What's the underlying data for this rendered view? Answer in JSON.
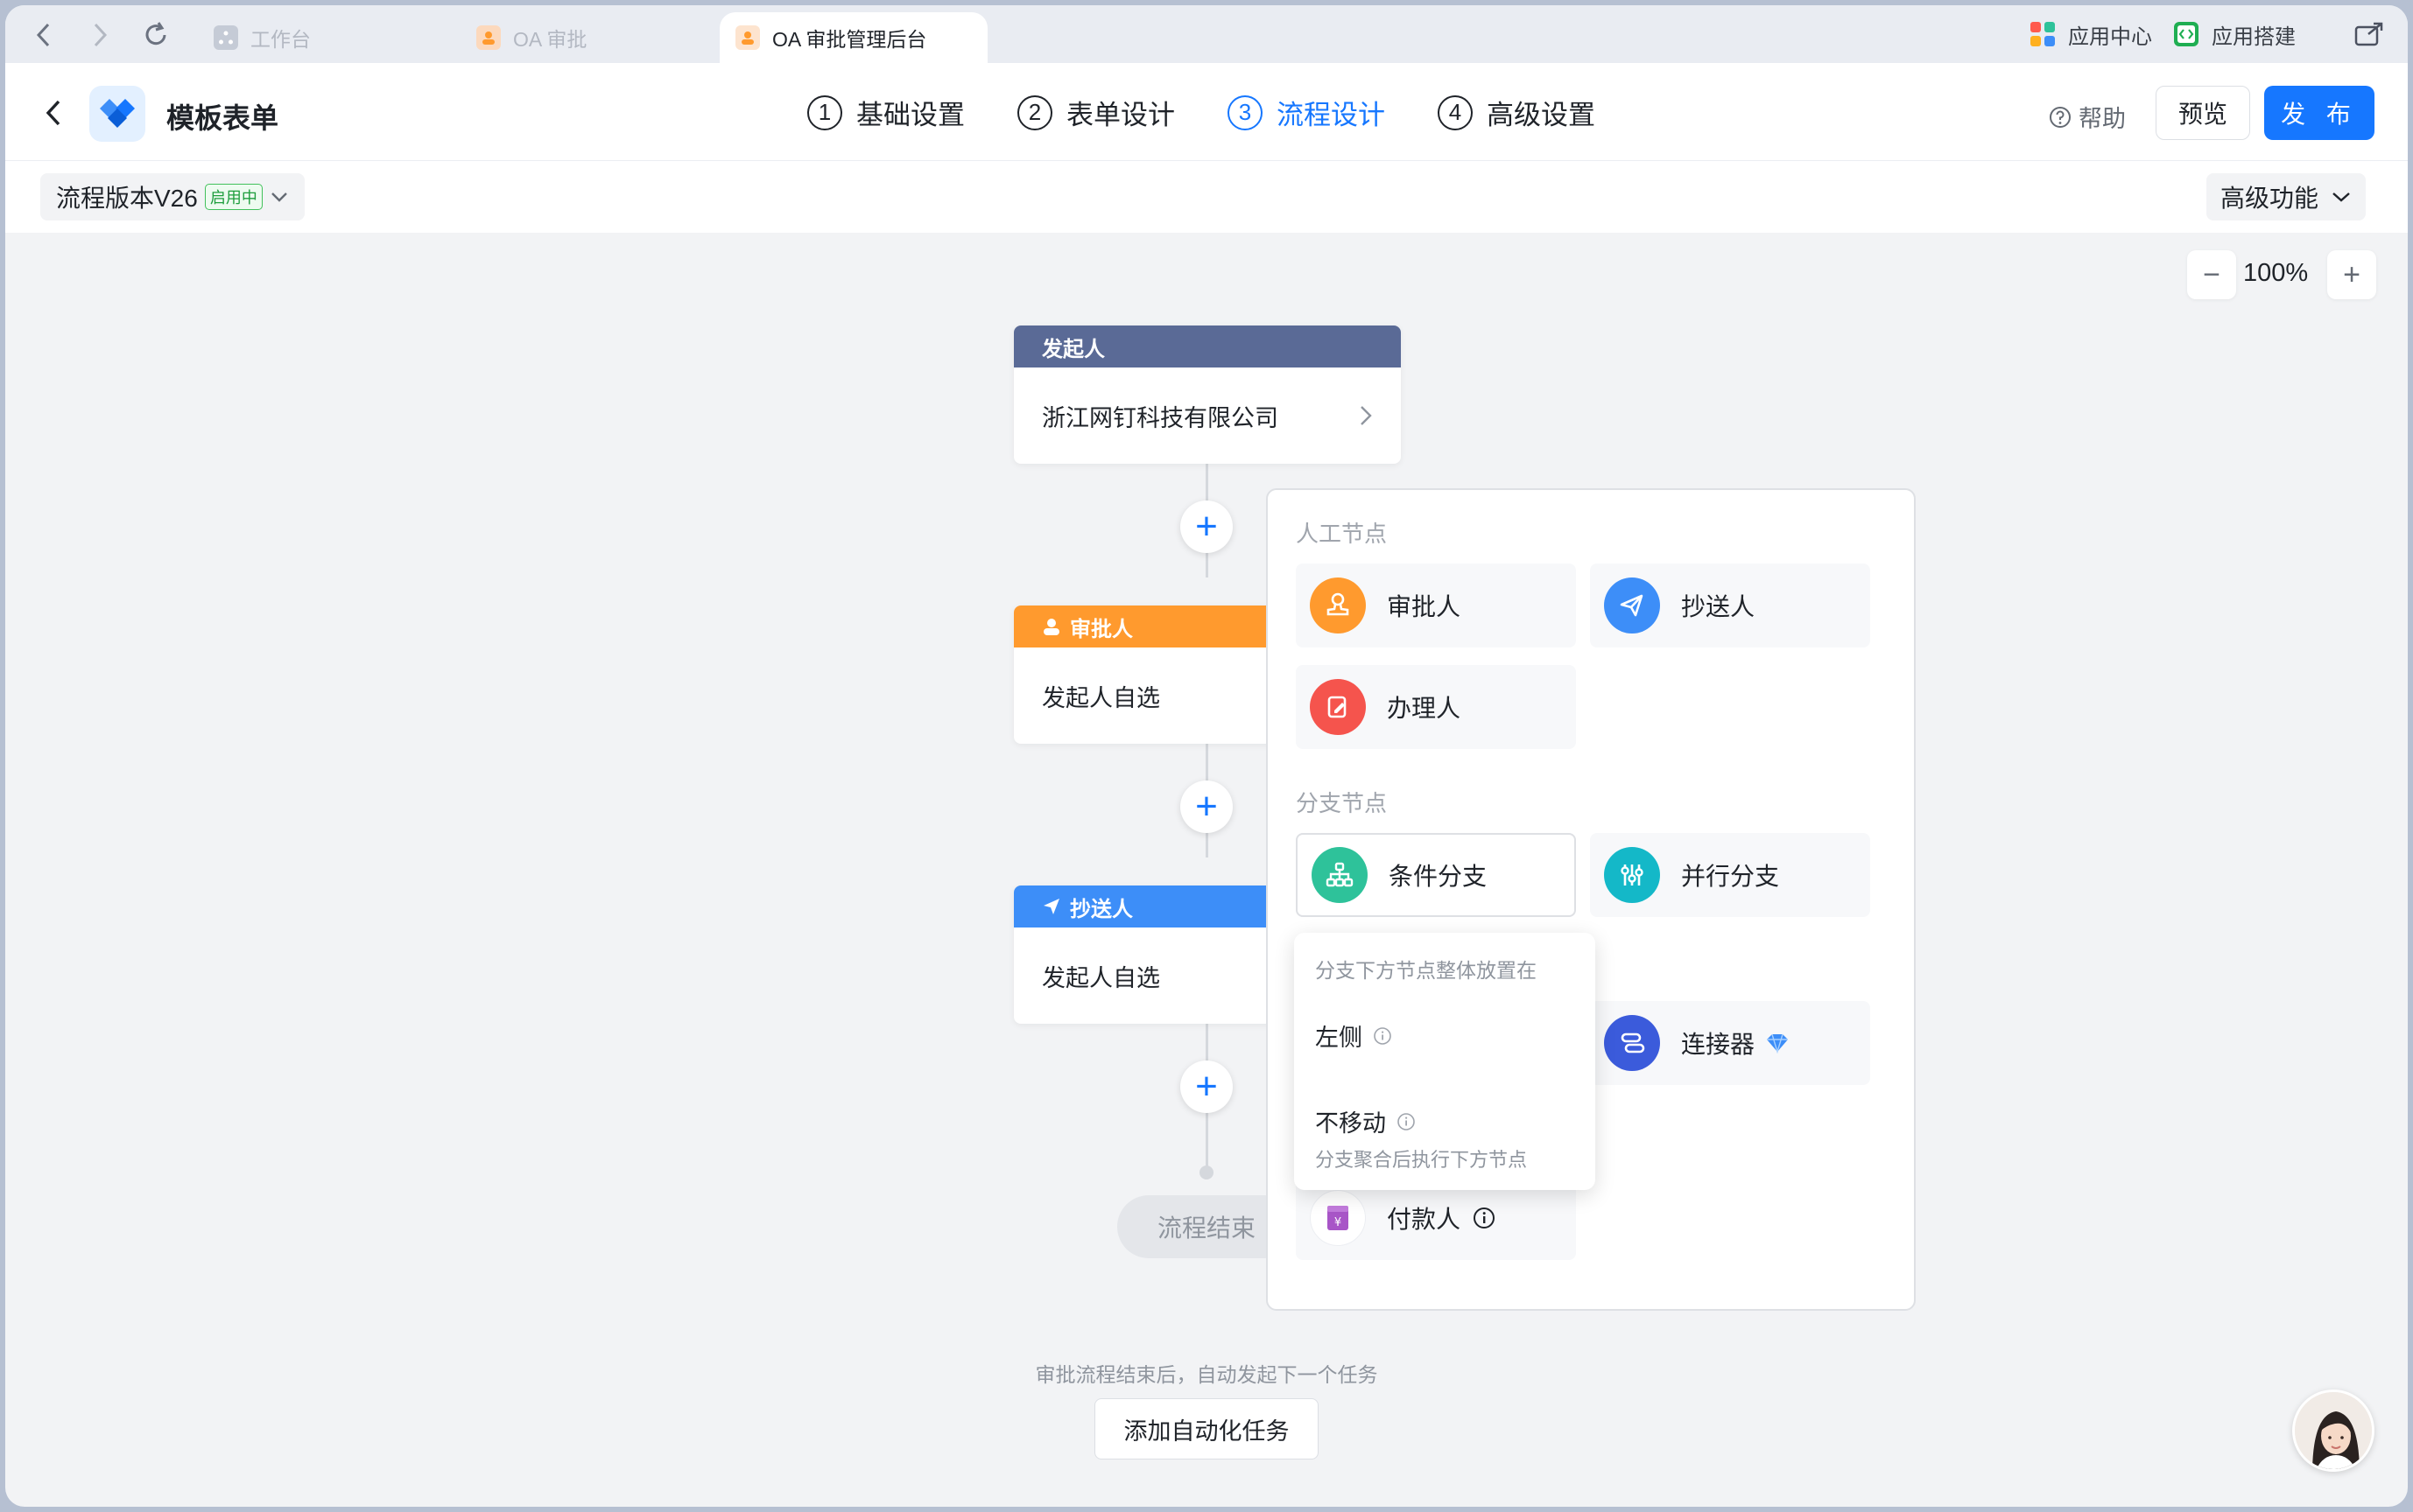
{
  "browser": {
    "tabs": [
      {
        "label": "工作台"
      },
      {
        "label": "OA 审批"
      },
      {
        "label": "OA 审批管理后台"
      }
    ],
    "app_center": "应用中心",
    "app_builder": "应用搭建"
  },
  "header": {
    "title": "模板表单",
    "steps": [
      {
        "num": "1",
        "label": "基础设置"
      },
      {
        "num": "2",
        "label": "表单设计"
      },
      {
        "num": "3",
        "label": "流程设计",
        "active": true
      },
      {
        "num": "4",
        "label": "高级设置"
      }
    ],
    "help": "帮助",
    "preview": "预览",
    "publish": "发 布"
  },
  "toolbar": {
    "version": "流程版本V26",
    "status_badge": "启用中",
    "advanced": "高级功能"
  },
  "zoom": {
    "level": "100%"
  },
  "flow": {
    "initiator": {
      "header": "发起人",
      "body": "浙江网钉科技有限公司"
    },
    "approver": {
      "header": "审批人",
      "body": "发起人自选"
    },
    "cc": {
      "header": "抄送人",
      "body": "发起人自选"
    },
    "end": "流程结束",
    "after_note": "审批流程结束后，自动发起下一个任务",
    "add_task": "添加自动化任务"
  },
  "picker": {
    "manual_title": "人工节点",
    "manual": [
      {
        "label": "审批人",
        "icon": "stamp-icon",
        "color": "#ff9a2e"
      },
      {
        "label": "抄送人",
        "icon": "send-icon",
        "color": "#3d8ef8"
      },
      {
        "label": "办理人",
        "icon": "edit-icon",
        "color": "#f5544d"
      }
    ],
    "branch_title": "分支节点",
    "branch": [
      {
        "label": "条件分支",
        "icon": "branch-icon",
        "color": "#2ec29a"
      },
      {
        "label": "并行分支",
        "icon": "parallel-icon",
        "color": "#14b8c8"
      }
    ],
    "connector": {
      "label": "连接器",
      "icon": "connector-icon",
      "color": "#3b5bdb"
    },
    "payer": {
      "label": "付款人",
      "icon": "wallet-icon",
      "color": "#a855c7"
    }
  },
  "popover": {
    "title": "分支下方节点整体放置在",
    "left": "左侧",
    "no_move": "不移动",
    "no_move_desc": "分支聚合后执行下方节点"
  }
}
